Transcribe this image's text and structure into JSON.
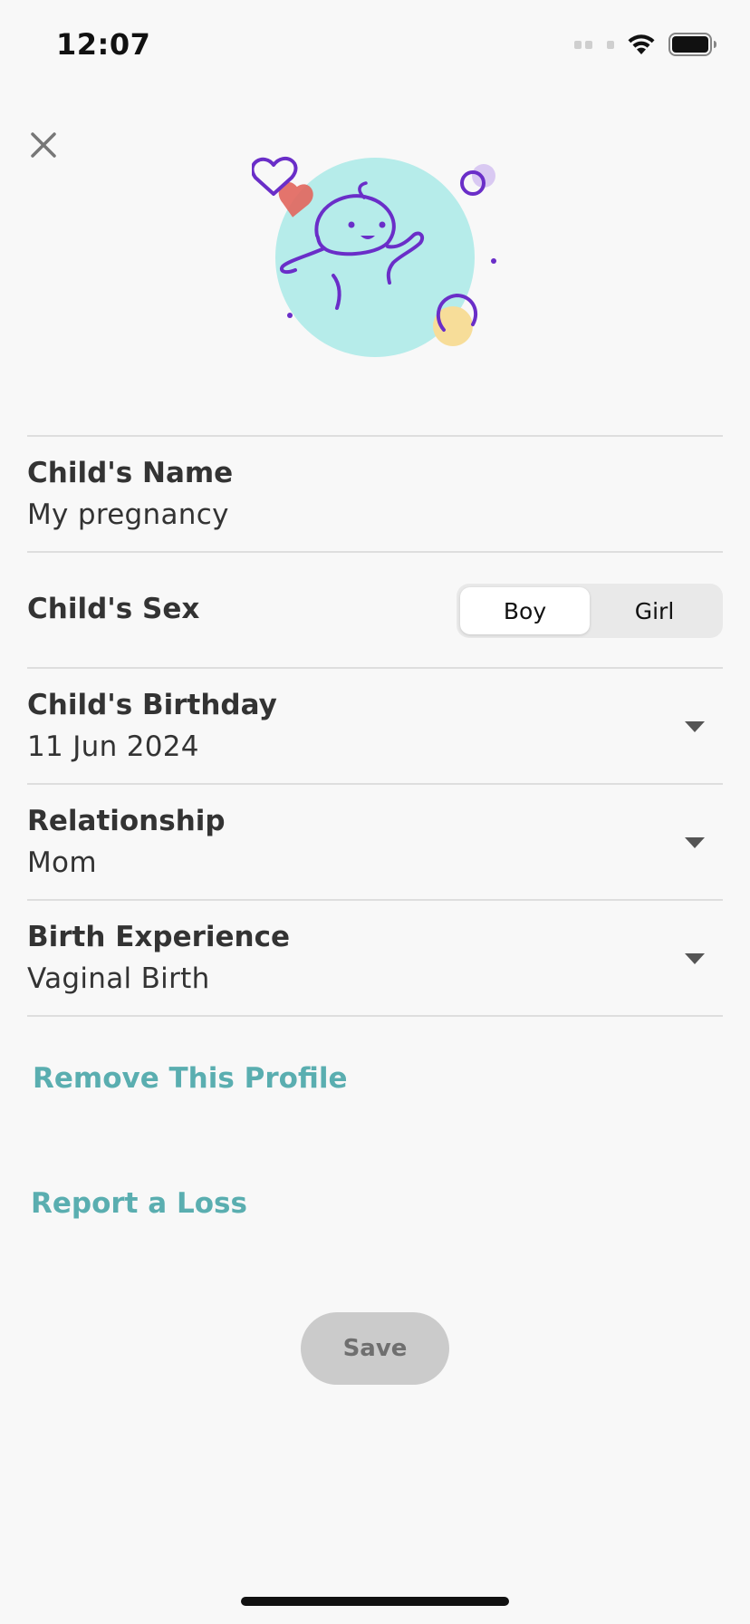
{
  "status_bar": {
    "time": "12:07",
    "wifi_icon": "wifi-icon",
    "battery_icon": "battery-icon",
    "signal_icon": "cellular-signal-icon"
  },
  "header": {
    "close_icon": "close-icon",
    "illustration": "baby-illustration"
  },
  "form": {
    "child_name": {
      "label": "Child's Name",
      "value": "My pregnancy"
    },
    "child_sex": {
      "label": "Child's Sex",
      "options": [
        "Boy",
        "Girl"
      ],
      "selected": "Boy"
    },
    "child_birthday": {
      "label": "Child's Birthday",
      "value": "11 Jun 2024"
    },
    "relationship": {
      "label": "Relationship",
      "value": "Mom"
    },
    "birth_experience": {
      "label": "Birth Experience",
      "value": "Vaginal Birth"
    }
  },
  "links": {
    "remove_profile": "Remove This Profile",
    "report_loss": "Report a Loss"
  },
  "actions": {
    "save_label": "Save"
  },
  "colors": {
    "accent_link": "#5aaeb0",
    "illustration_circle": "#b6ecea",
    "illustration_stroke": "#6a2ec8",
    "heart": "#e2685f",
    "yellow_dot": "#f7dd99",
    "save_disabled_bg": "#cbcbcb"
  }
}
